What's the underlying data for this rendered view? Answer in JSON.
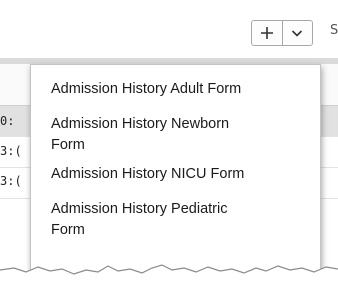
{
  "toolbar": {
    "add_label": "+",
    "dropdown_icon": "chevron-down-icon",
    "cut_label": "S"
  },
  "grid": {
    "rows": [
      {
        "value": "0:"
      },
      {
        "value": "3:("
      },
      {
        "value": "3:("
      }
    ]
  },
  "menu": {
    "items": [
      {
        "label": "Admission History Adult Form"
      },
      {
        "label": "Admission History Newborn Form"
      },
      {
        "label": "Admission History NICU Form"
      },
      {
        "label": "Admission History Pediatric Form"
      }
    ]
  }
}
